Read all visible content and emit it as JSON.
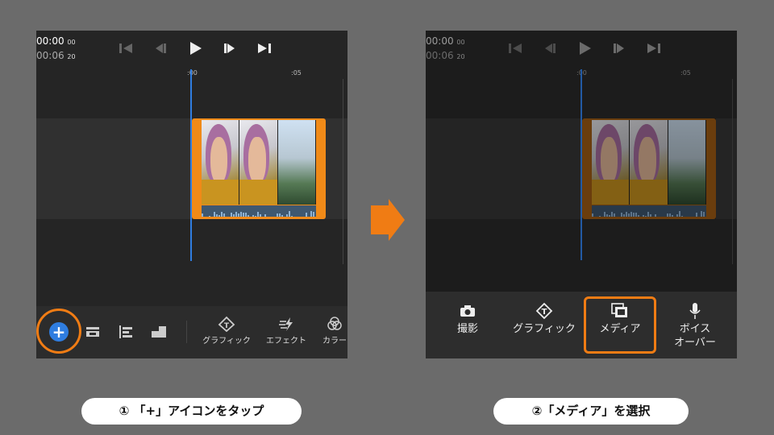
{
  "left_panel": {
    "timecode_current": "00:00",
    "timecode_current_frames": "00",
    "timecode_total": "00:06",
    "timecode_total_frames": "20",
    "ruler_labels": [
      ":00",
      ":05"
    ],
    "toolbar": {
      "add_button_label": "+",
      "items": [
        {
          "label": "グラフィック",
          "icon": "graphics-icon"
        },
        {
          "label": "エフェクト",
          "icon": "effects-icon"
        },
        {
          "label": "カラー",
          "icon": "color-icon"
        }
      ]
    }
  },
  "right_panel": {
    "timecode_current": "00:00",
    "timecode_current_frames": "00",
    "timecode_total": "00:06",
    "timecode_total_frames": "20",
    "ruler_labels": [
      ":00",
      ":05"
    ],
    "menu": [
      {
        "label": "撮影",
        "icon": "camera-icon"
      },
      {
        "label": "グラフィック",
        "icon": "graphics-icon"
      },
      {
        "label": "メディア",
        "icon": "media-icon"
      },
      {
        "label_line1": "ボイス",
        "label_line2": "オーバー",
        "icon": "microphone-icon"
      }
    ]
  },
  "captions": {
    "step1": "① 「+」アイコンをタップ",
    "step2": "②「メディア」を選択"
  },
  "colors": {
    "accent_orange": "#f07c14",
    "playhead_blue": "#2f7de0",
    "clip_orange": "#f08a18"
  }
}
